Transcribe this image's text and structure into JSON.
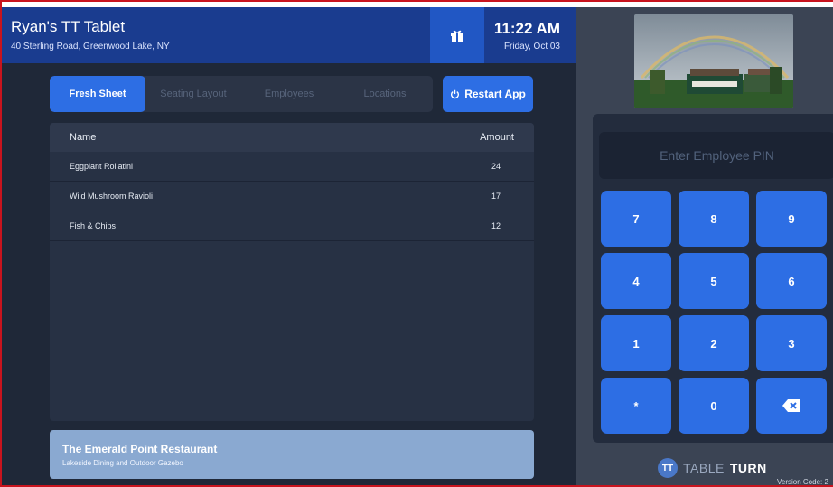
{
  "header": {
    "title": "Ryan's TT Tablet",
    "address": "40 Sterling Road, Greenwood Lake, NY",
    "gift_icon": "gift-icon",
    "time": "11:22 AM",
    "date": "Friday, Oct 03"
  },
  "tabs": [
    {
      "label": "Fresh Sheet",
      "active": true
    },
    {
      "label": "Seating Layout",
      "active": false
    },
    {
      "label": "Employees",
      "active": false
    },
    {
      "label": "Locations",
      "active": false
    }
  ],
  "restart": {
    "label": "Restart App",
    "icon": "power-icon"
  },
  "table": {
    "headers": [
      "Name",
      "Amount"
    ],
    "rows": [
      {
        "name": "Eggplant Rollatini",
        "amount": "24"
      },
      {
        "name": "Wild Mushroom Ravioli",
        "amount": "17"
      },
      {
        "name": "Fish & Chips",
        "amount": "12"
      }
    ]
  },
  "restaurant": {
    "name": "The Emerald Point Restaurant",
    "subtitle": "Lakeside Dining and Outdoor Gazebo"
  },
  "pin": {
    "placeholder": "Enter Employee PIN"
  },
  "keypad": [
    "7",
    "8",
    "9",
    "4",
    "5",
    "6",
    "1",
    "2",
    "3",
    "*",
    "0",
    "backspace"
  ],
  "brand": {
    "mark": "TT",
    "word1": "TABLE",
    "word2": "TURN"
  },
  "version": "Version Code: 2",
  "colors": {
    "header": "#1a3c8f",
    "accent": "#2d6ee4",
    "panel": "#1f2838"
  }
}
